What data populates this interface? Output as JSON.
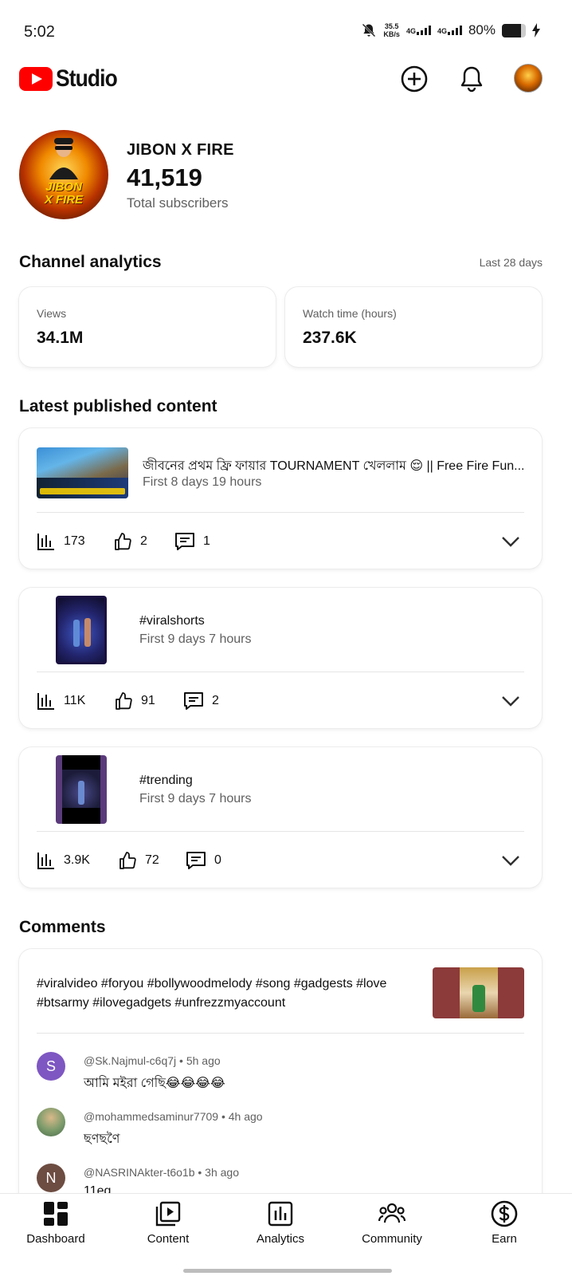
{
  "status_bar": {
    "time": "5:02",
    "speed_value": "35.5",
    "speed_unit": "KB/s",
    "network_1": "4G",
    "network_2": "4G",
    "battery": "80%"
  },
  "header": {
    "app_name": "Studio",
    "icons": [
      "create-icon",
      "notifications-icon",
      "account-avatar"
    ]
  },
  "channel": {
    "name": "JIBON X FIRE",
    "subscribers": "41,519",
    "subscribers_label": "Total subscribers",
    "avatar_text_1": "JIBON",
    "avatar_text_2": "X FIRE"
  },
  "analytics": {
    "title": "Channel analytics",
    "period": "Last 28 days",
    "metrics": [
      {
        "label": "Views",
        "value": "34.1M"
      },
      {
        "label": "Watch time (hours)",
        "value": "237.6K"
      }
    ]
  },
  "latest": {
    "title": "Latest published content",
    "items": [
      {
        "title": "জীবনের প্রথম ফ্রি ফায়ার TOURNAMENT খেললাম 😌 || Free Fire Fun...",
        "subtitle": "First 8 days 19 hours",
        "views": "173",
        "likes": "2",
        "comments": "1"
      },
      {
        "title": "#viralshorts",
        "subtitle": "First 9 days 7 hours",
        "views": "11K",
        "likes": "91",
        "comments": "2"
      },
      {
        "title": "#trending",
        "subtitle": "First 9 days 7 hours",
        "views": "3.9K",
        "likes": "72",
        "comments": "0"
      }
    ]
  },
  "comments": {
    "title": "Comments",
    "video_title_line1": "#viralvideo #foryou #bollywoodmelody #song #gadgests #love",
    "video_title_line2": "#btsarmy #ilovegadgets #unfrezzmyaccount",
    "items": [
      {
        "initial": "S",
        "author": "@Sk.Najmul-c6q7j",
        "time": "5h ago",
        "text": "আমি মইরা গেছি😂😂😂😂",
        "color": "#7e57c2"
      },
      {
        "initial": "",
        "author": "@mohammedsaminur7709",
        "time": "4h ago",
        "text": "ছণছণৈ",
        "color": "#6d8a6a"
      },
      {
        "initial": "N",
        "author": "@NASRINAkter-t6o1b",
        "time": "3h ago",
        "text": "11eq",
        "color": "#6d4c41"
      }
    ]
  },
  "nav": {
    "items": [
      {
        "label": "Dashboard",
        "icon": "dashboard-icon"
      },
      {
        "label": "Content",
        "icon": "content-icon"
      },
      {
        "label": "Analytics",
        "icon": "analytics-icon"
      },
      {
        "label": "Community",
        "icon": "community-icon"
      },
      {
        "label": "Earn",
        "icon": "earn-icon"
      }
    ]
  },
  "colors": {
    "brand_red": "#ff0000",
    "text_secondary": "#606060"
  }
}
